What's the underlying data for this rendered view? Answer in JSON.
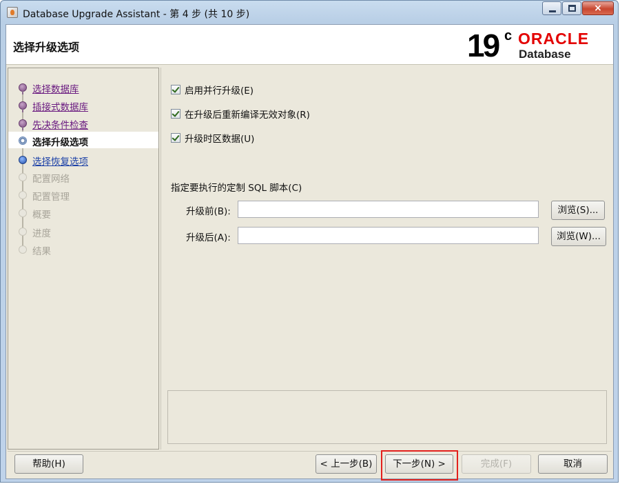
{
  "window": {
    "title": "Database Upgrade Assistant - 第 4 步 (共 10 步)",
    "controls": {
      "minimize": "minimize",
      "maximize": "maximize",
      "close": "×"
    }
  },
  "header": {
    "page_title": "选择升级选项",
    "logo": {
      "version": "19",
      "superscript": "c",
      "brand": "ORACLE",
      "product": "Database",
      "brand_color": "#e30000"
    }
  },
  "sidebar": {
    "steps": [
      {
        "label": "选择数据库",
        "state": "done"
      },
      {
        "label": "插接式数据库",
        "state": "done"
      },
      {
        "label": "先决条件检查",
        "state": "done"
      },
      {
        "label": "选择升级选项",
        "state": "current"
      },
      {
        "label": "选择恢复选项",
        "state": "next"
      },
      {
        "label": "配置网络",
        "state": "pending"
      },
      {
        "label": "配置管理",
        "state": "pending"
      },
      {
        "label": "概要",
        "state": "pending"
      },
      {
        "label": "进度",
        "state": "pending"
      },
      {
        "label": "结果",
        "state": "pending"
      }
    ]
  },
  "options": {
    "parallel_upgrade": {
      "label": "启用并行升级(E)",
      "checked": true
    },
    "recompile_invalid": {
      "label": "在升级后重新编译无效对象(R)",
      "checked": true
    },
    "timezone_upgrade": {
      "label": "升级时区数据(U)",
      "checked": true
    },
    "custom_sql_label": "指定要执行的定制 SQL 脚本(C)",
    "before_label": "升级前(B):",
    "before_value": "",
    "after_label": "升级后(A):",
    "after_value": "",
    "browse_before": "浏览(S)...",
    "browse_after": "浏览(W)..."
  },
  "footer": {
    "help": "帮助(H)",
    "back": "< 上一步(B)",
    "next": "下一步(N) >",
    "finish": "完成(F)",
    "cancel": "取消"
  },
  "colors": {
    "highlight_box": "#e3201c",
    "visited_link": "#6a1a80",
    "next_link": "#1a3fa6"
  }
}
